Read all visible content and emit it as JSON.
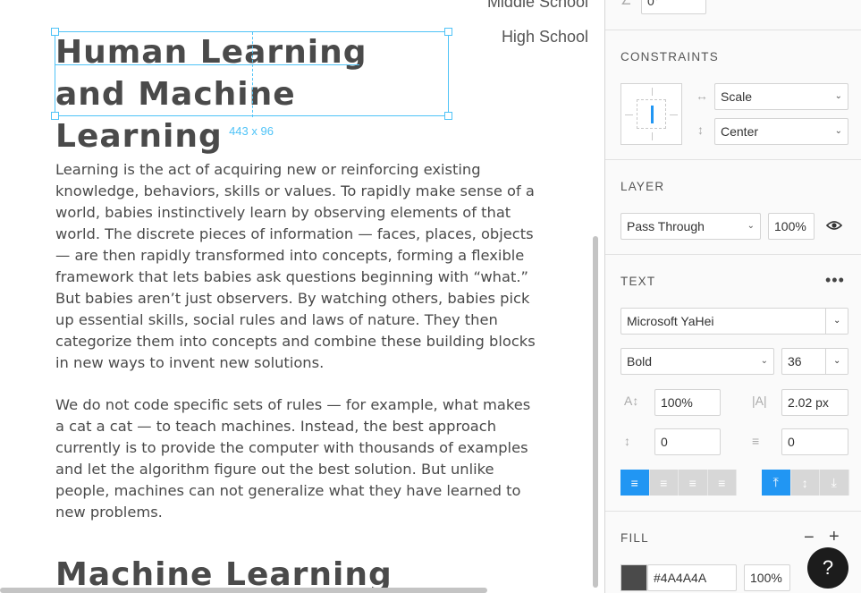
{
  "canvas": {
    "outline": [
      "Middle School",
      "High School"
    ],
    "selection_size": "443 x 96",
    "title_lines": [
      "Human Learning",
      "and Machine Learning"
    ],
    "paragraph1": "Learning is the act of acquiring new or reinforcing existing knowledge, behaviors, skills or values. To rapidly make sense of a world, babies instinctively learn by observing elements of that world. The discrete pieces of information — faces, places, objects — are then rapidly transformed into concepts, forming a flexible framework that lets babies ask questions beginning with “what.” But babies aren’t just observers. By watching others, babies pick up essential skills, social rules and laws of nature. They then categorize them into concepts and combine these building blocks in new ways to invent new solutions.",
    "paragraph2": "We do not code specific sets of rules — for example, what makes a cat a cat — to teach machines. Instead, the best approach currently is to provide the computer with thousands of examples and let the algorithm figure out the best solution. But unlike people, machines can not generalize what they have learned to new problems.",
    "heading2": "Machine Learning"
  },
  "inspector": {
    "rotation_value": "0°",
    "constraints": {
      "title": "CONSTRAINTS",
      "horizontal": "Scale",
      "vertical": "Center"
    },
    "layer": {
      "title": "LAYER",
      "blend_mode": "Pass Through",
      "opacity": "100%"
    },
    "text": {
      "title": "TEXT",
      "font_family": "Microsoft YaHei",
      "font_weight": "Bold",
      "font_size": "36",
      "line_height": "100%",
      "letter_spacing": "2.02 px",
      "paragraph_spacing": "0",
      "indent": "0"
    },
    "fill": {
      "title": "FILL",
      "hex": "#4A4A4A",
      "opacity": "100%",
      "color": "#4a4a4a"
    }
  },
  "help": {
    "label": "?"
  },
  "colors": {
    "accent": "#2196f3",
    "selection": "#4fc3f7",
    "text": "#4a4a4a"
  }
}
